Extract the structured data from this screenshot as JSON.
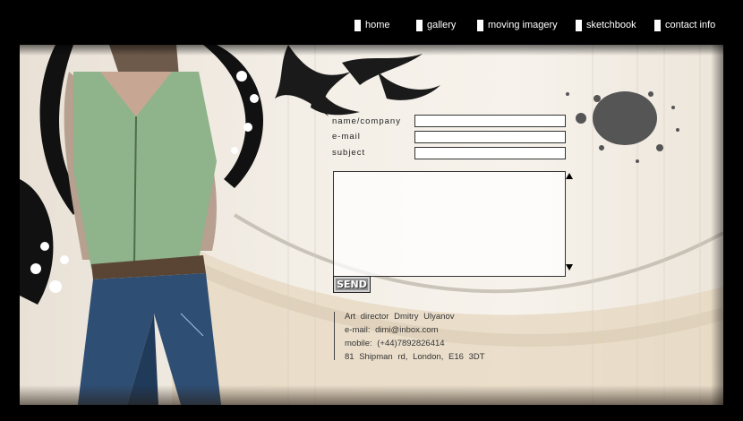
{
  "nav": {
    "items": [
      {
        "label": "home"
      },
      {
        "label": "gallery"
      },
      {
        "label": "moving imagery"
      },
      {
        "label": "sketchbook"
      },
      {
        "label": "contact info"
      }
    ]
  },
  "form": {
    "name_label": "name/company",
    "email_label": "e-mail",
    "subject_label": "subject",
    "send_label": "SEND"
  },
  "contact": {
    "line1": "Art director Dmitry Ulyanov",
    "line2": "e-mail: dimi@inbox.com",
    "line3": "mobile: (+44)7892826414",
    "line4": "81 Shipman rd, London, E16 3DT"
  },
  "colors": {
    "background": "#000000",
    "nav_text": "#ffffff",
    "paper": "#f3eee6",
    "ink": "#222222",
    "send_button": "#8d8d8d"
  }
}
